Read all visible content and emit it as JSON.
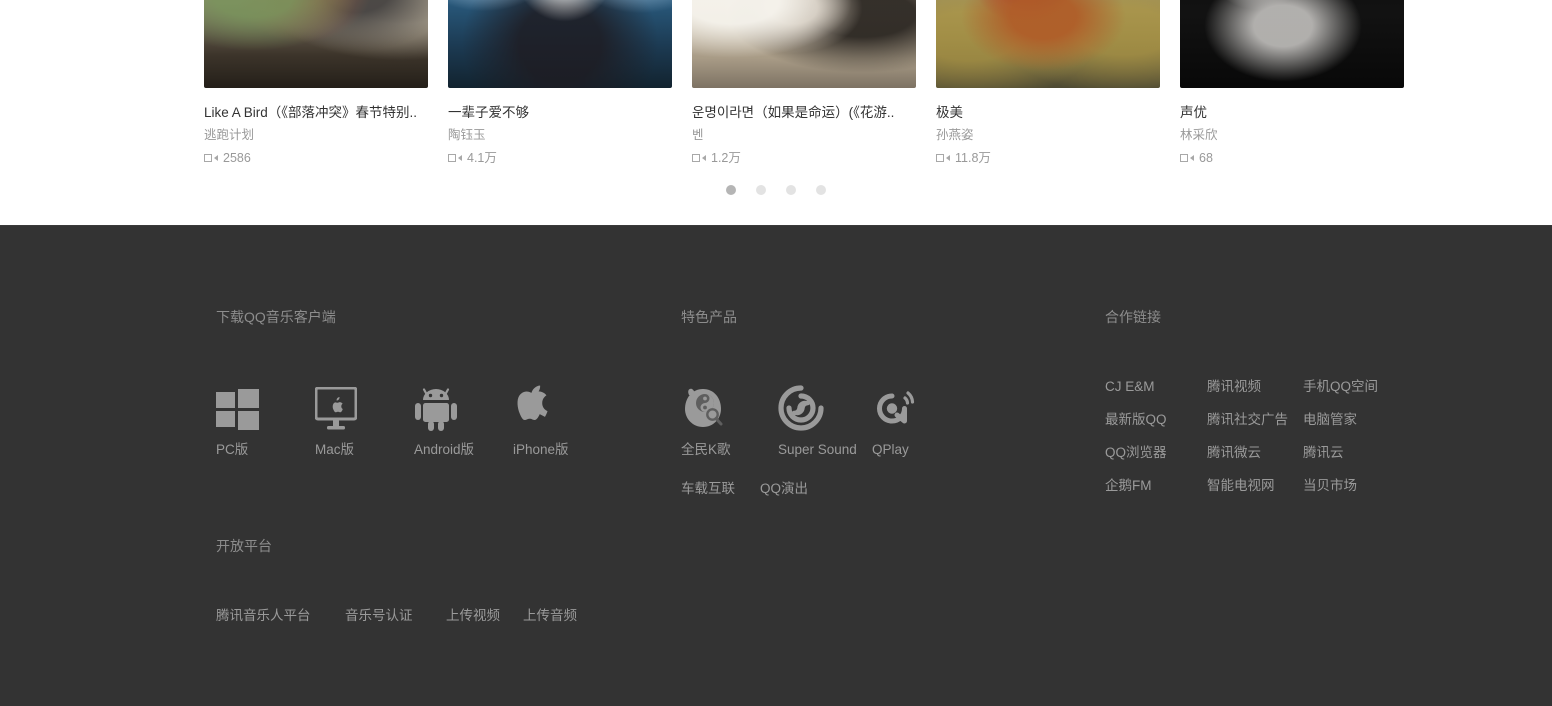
{
  "mv_carousel": {
    "cards": [
      {
        "title": "Like A Bird（《部落冲突》春节特别..",
        "artist": "逃跑计划",
        "plays": "2586",
        "play_icon": "video-camera-icon",
        "thumb_desc": "indoor-band-scene"
      },
      {
        "title": "一辈子爱不够",
        "artist": "陶钰玉",
        "plays": "4.1万",
        "play_icon": "video-camera-icon",
        "thumb_desc": "blue-stage-scene"
      },
      {
        "title": "운명이라면（如果是命运）(《花游..",
        "artist": "벤",
        "plays": "1.2万",
        "play_icon": "video-camera-icon",
        "thumb_desc": "wedding-scene"
      },
      {
        "title": "极美",
        "artist": "孙燕姿",
        "plays": "11.8万",
        "play_icon": "video-camera-icon",
        "thumb_desc": "autumn-field-scene"
      },
      {
        "title": "声优",
        "artist": "林采欣",
        "plays": "68",
        "play_icon": "video-camera-icon",
        "thumb_desc": "bw-performance-scene"
      }
    ],
    "dots": [
      {
        "active": true
      },
      {
        "active": false
      },
      {
        "active": false
      },
      {
        "active": false
      }
    ]
  },
  "footer": {
    "download": {
      "heading": "下载QQ音乐客户端",
      "items": [
        {
          "label": "PC版",
          "icon": "windows-icon"
        },
        {
          "label": "Mac版",
          "icon": "mac-desktop-icon"
        },
        {
          "label": "Android版",
          "icon": "android-icon"
        },
        {
          "label": "iPhone版",
          "icon": "apple-icon"
        }
      ]
    },
    "products": {
      "heading": "特色产品",
      "items": [
        {
          "label": "全民K歌",
          "icon": "kge-penguin-mic-icon"
        },
        {
          "label": "Super Sound",
          "icon": "super-sound-swirl-icon"
        },
        {
          "label": "QPlay",
          "icon": "qplay-wave-icon"
        }
      ],
      "extra_links": [
        "车载互联",
        "QQ演出"
      ]
    },
    "partner_links": {
      "heading": "合作链接",
      "items": [
        "CJ E&M",
        "腾讯视频",
        "手机QQ空间",
        "最新版QQ",
        "腾讯社交广告",
        "电脑管家",
        "QQ浏览器",
        "腾讯微云",
        "腾讯云",
        "企鹅FM",
        "智能电视网",
        "当贝市场"
      ]
    },
    "open_platform": {
      "heading": "开放平台",
      "items": [
        "腾讯音乐人平台",
        "音乐号认证",
        "上传视频",
        "上传音频"
      ]
    },
    "colors": {
      "background": "#333333",
      "heading_text": "#8d8d8d",
      "link_text": "#9a9a9a",
      "icon_fill": "#9a9a9a"
    }
  }
}
